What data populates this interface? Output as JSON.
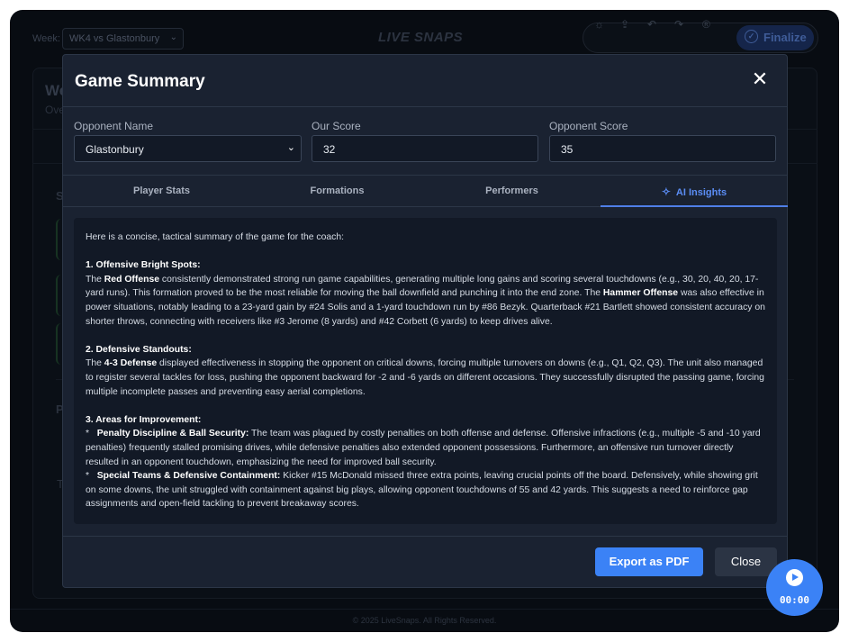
{
  "header": {
    "week_label": "Week:",
    "week_value": "WK4 vs Glastonbury",
    "brand": "LIVE SNAPS",
    "finalize_label": "Finalize"
  },
  "background": {
    "title": "We",
    "subtitle": "Ove",
    "section_s": "S",
    "section_p": "Pa",
    "section_t": "T"
  },
  "modal": {
    "title": "Game Summary",
    "fields": {
      "opponent_label": "Opponent Name",
      "opponent_value": "Glastonbury",
      "our_score_label": "Our Score",
      "our_score_value": "32",
      "opp_score_label": "Opponent Score",
      "opp_score_value": "35"
    },
    "tabs": [
      "Player Stats",
      "Formations",
      "Performers",
      "AI Insights"
    ],
    "active_tab": "AI Insights",
    "insights": {
      "intro": "Here is a concise, tactical summary of the game for the coach:",
      "s1_heading": "1. Offensive Bright Spots:",
      "s1_a": "The ",
      "s1_b": "Red Offense",
      "s1_c": " consistently demonstrated strong run game capabilities, generating multiple long gains and scoring several touchdowns (e.g., 30, 20, 40, 20, 17-yard runs). This formation proved to be the most reliable for moving the ball downfield and punching it into the end zone. The ",
      "s1_d": "Hammer Offense",
      "s1_e": " was also effective in power situations, notably leading to a 23-yard gain by #24 Solis and a 1-yard touchdown run by #86 Bezyk. Quarterback #21 Bartlett showed consistent accuracy on shorter throws, connecting with receivers like #3 Jerome (8 yards) and #42 Corbett (6 yards) to keep drives alive.",
      "s2_heading": "2. Defensive Standouts:",
      "s2_a": "The ",
      "s2_b": "4-3 Defense",
      "s2_c": " displayed effectiveness in stopping the opponent on critical downs, forcing multiple turnovers on downs (e.g., Q1, Q2, Q3). The unit also managed to register several tackles for loss, pushing the opponent backward for -2 and -6 yards on different occasions. They successfully disrupted the passing game, forcing multiple incomplete passes and preventing easy aerial completions.",
      "s3_heading": "3. Areas for Improvement:",
      "s3_b1_bullet": "*",
      "s3_b1_head": "Penalty Discipline & Ball Security:",
      "s3_b1_text": " The team was plagued by costly penalties on both offense and defense. Offensive infractions (e.g., multiple -5 and -10 yard penalties) frequently stalled promising drives, while defensive penalties also extended opponent possessions. Furthermore, an offensive run turnover directly resulted in an opponent touchdown, emphasizing the need for improved ball security.",
      "s3_b2_bullet": "*",
      "s3_b2_head": "Special Teams & Defensive Containment:",
      "s3_b2_text": " Kicker #15 McDonald missed three extra points, leaving crucial points off the board. Defensively, while showing grit on some downs, the unit struggled with containment against big plays, allowing opponent touchdowns of 55 and 42 yards. This suggests a need to reinforce gap assignments and open-field tackling to prevent breakaway scores."
    },
    "export_label": "Export as PDF",
    "close_label": "Close"
  },
  "timer": {
    "time": "00:00"
  },
  "footer": {
    "copyright": "© 2025 LiveSnaps. All Rights Reserved."
  },
  "colors": {
    "accent": "#3b82f6",
    "modal_bg": "#1a2231",
    "panel_bg": "#121926"
  }
}
